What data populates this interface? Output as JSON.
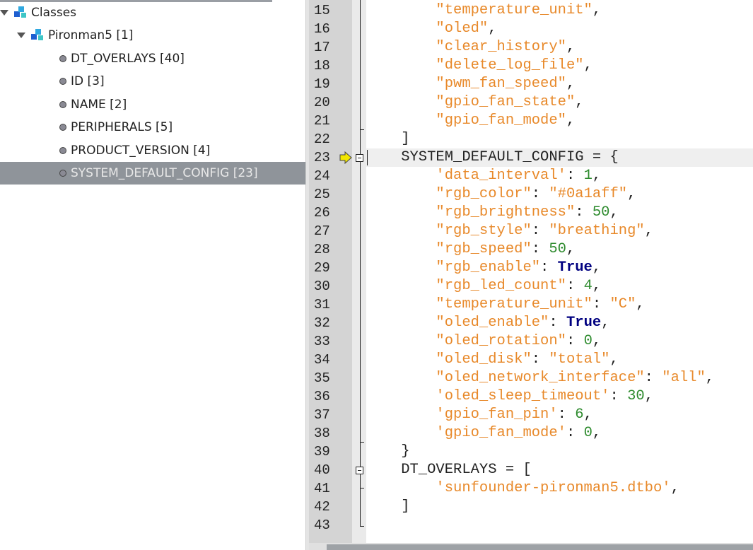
{
  "tree": {
    "root": {
      "label": "Classes"
    },
    "class": {
      "label": "Pironman5 [1]"
    },
    "members": [
      {
        "label": "DT_OVERLAYS [40]"
      },
      {
        "label": "ID [3]"
      },
      {
        "label": "NAME [2]"
      },
      {
        "label": "PERIPHERALS [5]"
      },
      {
        "label": "PRODUCT_VERSION [4]"
      },
      {
        "label": "SYSTEM_DEFAULT_CONFIG [23]",
        "selected": true
      }
    ]
  },
  "editor": {
    "current_line": 23,
    "colors": {
      "string": "#e8892a",
      "number": "#2e8b2e",
      "keyword": "#000080"
    },
    "lines": [
      {
        "n": "15",
        "t": [
          [
            "p",
            "        "
          ],
          [
            "s",
            "\"temperature_unit\""
          ],
          [
            "p",
            ","
          ]
        ]
      },
      {
        "n": "16",
        "t": [
          [
            "p",
            "        "
          ],
          [
            "s",
            "\"oled\""
          ],
          [
            "p",
            ","
          ]
        ]
      },
      {
        "n": "17",
        "t": [
          [
            "p",
            "        "
          ],
          [
            "s",
            "\"clear_history\""
          ],
          [
            "p",
            ","
          ]
        ]
      },
      {
        "n": "18",
        "t": [
          [
            "p",
            "        "
          ],
          [
            "s",
            "\"delete_log_file\""
          ],
          [
            "p",
            ","
          ]
        ]
      },
      {
        "n": "19",
        "t": [
          [
            "p",
            "        "
          ],
          [
            "s",
            "\"pwm_fan_speed\""
          ],
          [
            "p",
            ","
          ]
        ]
      },
      {
        "n": "20",
        "t": [
          [
            "p",
            "        "
          ],
          [
            "s",
            "\"gpio_fan_state\""
          ],
          [
            "p",
            ","
          ]
        ]
      },
      {
        "n": "21",
        "t": [
          [
            "p",
            "        "
          ],
          [
            "s",
            "\"gpio_fan_mode\""
          ],
          [
            "p",
            ","
          ]
        ]
      },
      {
        "n": "22",
        "t": [
          [
            "p",
            "    ]"
          ]
        ]
      },
      {
        "n": "23",
        "t": [
          [
            "p",
            "    SYSTEM_DEFAULT_CONFIG = {"
          ]
        ]
      },
      {
        "n": "24",
        "t": [
          [
            "p",
            "        "
          ],
          [
            "s",
            "'data_interval'"
          ],
          [
            "p",
            ": "
          ],
          [
            "n",
            "1"
          ],
          [
            "p",
            ","
          ]
        ]
      },
      {
        "n": "25",
        "t": [
          [
            "p",
            "        "
          ],
          [
            "s",
            "\"rgb_color\""
          ],
          [
            "p",
            ": "
          ],
          [
            "s",
            "\"#0a1aff\""
          ],
          [
            "p",
            ","
          ]
        ]
      },
      {
        "n": "26",
        "t": [
          [
            "p",
            "        "
          ],
          [
            "s",
            "\"rgb_brightness\""
          ],
          [
            "p",
            ": "
          ],
          [
            "n",
            "50"
          ],
          [
            "p",
            ","
          ]
        ]
      },
      {
        "n": "27",
        "t": [
          [
            "p",
            "        "
          ],
          [
            "s",
            "\"rgb_style\""
          ],
          [
            "p",
            ": "
          ],
          [
            "s",
            "\"breathing\""
          ],
          [
            "p",
            ","
          ]
        ]
      },
      {
        "n": "28",
        "t": [
          [
            "p",
            "        "
          ],
          [
            "s",
            "\"rgb_speed\""
          ],
          [
            "p",
            ": "
          ],
          [
            "n",
            "50"
          ],
          [
            "p",
            ","
          ]
        ]
      },
      {
        "n": "29",
        "t": [
          [
            "p",
            "        "
          ],
          [
            "s",
            "\"rgb_enable\""
          ],
          [
            "p",
            ": "
          ],
          [
            "k",
            "True"
          ],
          [
            "p",
            ","
          ]
        ]
      },
      {
        "n": "30",
        "t": [
          [
            "p",
            "        "
          ],
          [
            "s",
            "\"rgb_led_count\""
          ],
          [
            "p",
            ": "
          ],
          [
            "n",
            "4"
          ],
          [
            "p",
            ","
          ]
        ]
      },
      {
        "n": "31",
        "t": [
          [
            "p",
            "        "
          ],
          [
            "s",
            "\"temperature_unit\""
          ],
          [
            "p",
            ": "
          ],
          [
            "s",
            "\"C\""
          ],
          [
            "p",
            ","
          ]
        ]
      },
      {
        "n": "32",
        "t": [
          [
            "p",
            "        "
          ],
          [
            "s",
            "\"oled_enable\""
          ],
          [
            "p",
            ": "
          ],
          [
            "k",
            "True"
          ],
          [
            "p",
            ","
          ]
        ]
      },
      {
        "n": "33",
        "t": [
          [
            "p",
            "        "
          ],
          [
            "s",
            "\"oled_rotation\""
          ],
          [
            "p",
            ": "
          ],
          [
            "n",
            "0"
          ],
          [
            "p",
            ","
          ]
        ]
      },
      {
        "n": "34",
        "t": [
          [
            "p",
            "        "
          ],
          [
            "s",
            "\"oled_disk\""
          ],
          [
            "p",
            ": "
          ],
          [
            "s",
            "\"total\""
          ],
          [
            "p",
            ","
          ]
        ]
      },
      {
        "n": "35",
        "t": [
          [
            "p",
            "        "
          ],
          [
            "s",
            "\"oled_network_interface\""
          ],
          [
            "p",
            ": "
          ],
          [
            "s",
            "\"all\""
          ],
          [
            "p",
            ","
          ]
        ]
      },
      {
        "n": "36",
        "t": [
          [
            "p",
            "        "
          ],
          [
            "s",
            "'oled_sleep_timeout'"
          ],
          [
            "p",
            ": "
          ],
          [
            "n",
            "30"
          ],
          [
            "p",
            ","
          ]
        ]
      },
      {
        "n": "37",
        "t": [
          [
            "p",
            "        "
          ],
          [
            "s",
            "'gpio_fan_pin'"
          ],
          [
            "p",
            ": "
          ],
          [
            "n",
            "6"
          ],
          [
            "p",
            ","
          ]
        ]
      },
      {
        "n": "38",
        "t": [
          [
            "p",
            "        "
          ],
          [
            "s",
            "'gpio_fan_mode'"
          ],
          [
            "p",
            ": "
          ],
          [
            "n",
            "0"
          ],
          [
            "p",
            ","
          ]
        ]
      },
      {
        "n": "39",
        "t": [
          [
            "p",
            "    }"
          ]
        ]
      },
      {
        "n": "40",
        "t": [
          [
            "p",
            "    DT_OVERLAYS = ["
          ]
        ]
      },
      {
        "n": "41",
        "t": [
          [
            "p",
            "        "
          ],
          [
            "s",
            "'sunfounder-pironman5.dtbo'"
          ],
          [
            "p",
            ","
          ]
        ]
      },
      {
        "n": "42",
        "t": [
          [
            "p",
            "    ]"
          ]
        ]
      },
      {
        "n": "43",
        "t": []
      }
    ]
  }
}
